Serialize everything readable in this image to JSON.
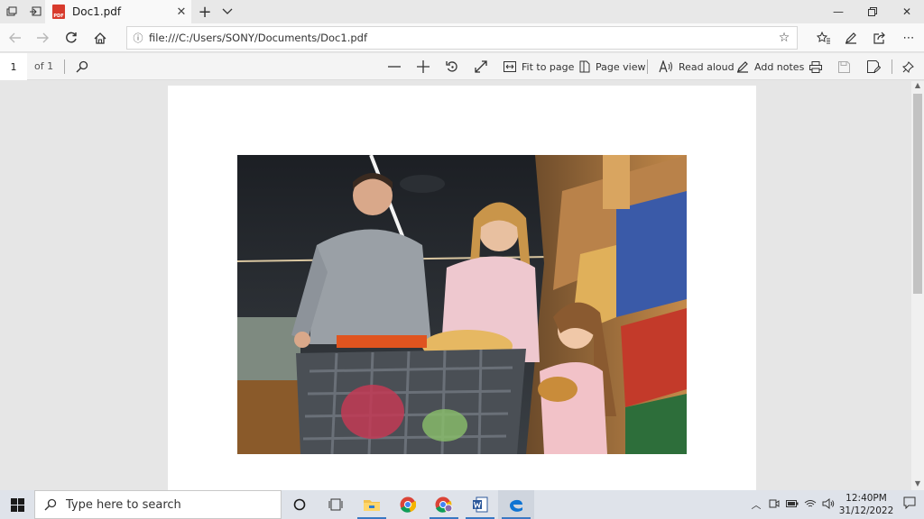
{
  "tab": {
    "title": "Doc1.pdf",
    "close": "✕"
  },
  "address": {
    "url": "file:///C:/Users/SONY/Documents/Doc1.pdf"
  },
  "pdf_toolbar": {
    "page_number": "1",
    "page_count": "of 1",
    "fit_to_page": "Fit to page",
    "page_view": "Page view",
    "read_aloud": "Read aloud",
    "add_notes": "Add notes"
  },
  "taskbar": {
    "search_placeholder": "Type here to search",
    "time": "12:40PM",
    "date": "31/12/2022"
  },
  "colors": {
    "accent": "#3a78c3",
    "pdf_red": "#d83b2d",
    "edge_blue": "#0f74d3"
  }
}
